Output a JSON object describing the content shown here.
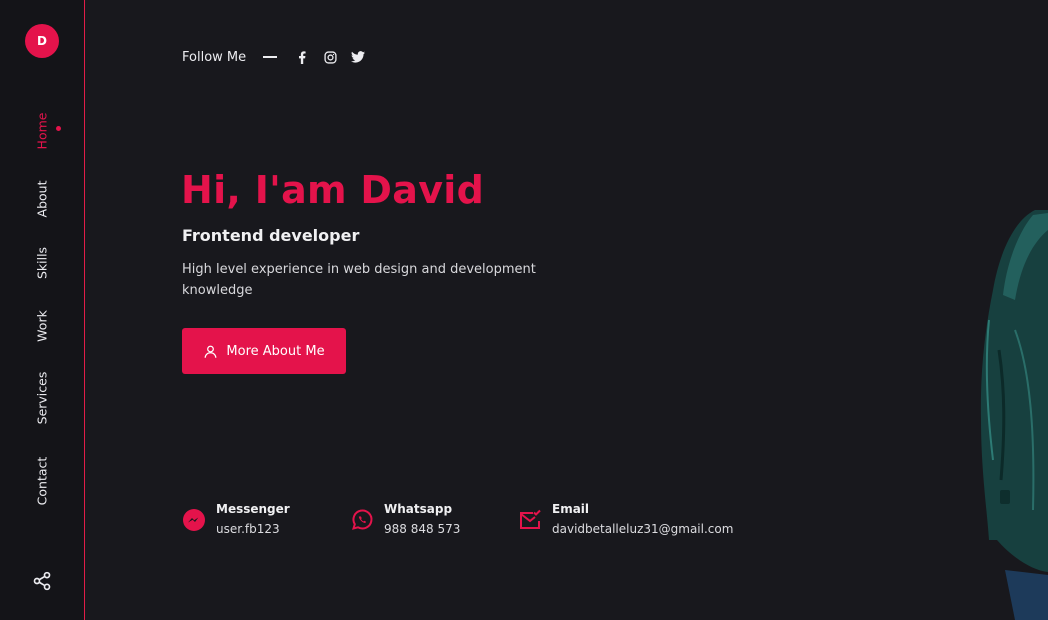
{
  "sidebar": {
    "logo_letter": "D",
    "nav": [
      {
        "label": "Home",
        "active": true
      },
      {
        "label": "About",
        "active": false
      },
      {
        "label": "Skills",
        "active": false
      },
      {
        "label": "Work",
        "active": false
      },
      {
        "label": "Services",
        "active": false
      },
      {
        "label": "Contact",
        "active": false
      }
    ],
    "share_icon": "share-icon"
  },
  "follow": {
    "label": "Follow Me",
    "icons": [
      "facebook-icon",
      "instagram-icon",
      "twitter-icon"
    ]
  },
  "hero": {
    "title": "Hi, I'am David",
    "subtitle": "Frontend developer",
    "description": "High level experience in web design and development knowledge",
    "button_label": "More About Me",
    "button_icon": "user-icon"
  },
  "contacts": [
    {
      "icon": "messenger-icon",
      "title": "Messenger",
      "value": "user.fb123"
    },
    {
      "icon": "whatsapp-icon",
      "title": "Whatsapp",
      "value": "988 848 573"
    },
    {
      "icon": "email-icon",
      "title": "Email",
      "value": "davidbetalleluz31@gmail.com"
    }
  ],
  "colors": {
    "accent": "#e4134b",
    "background": "#18181d",
    "sidebar": "#141418",
    "text": "#ececf0"
  }
}
